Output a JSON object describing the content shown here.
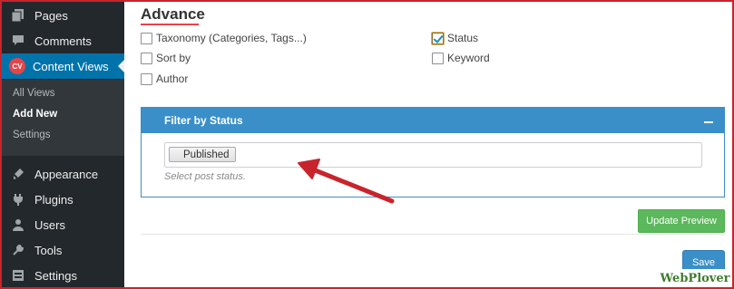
{
  "sidebar": {
    "items": [
      {
        "label": "Pages",
        "icon": "pages-icon"
      },
      {
        "label": "Comments",
        "icon": "comments-icon"
      },
      {
        "label": "Content Views",
        "icon": "content-views-icon",
        "badge": "CV"
      },
      {
        "label": "Appearance",
        "icon": "appearance-icon"
      },
      {
        "label": "Plugins",
        "icon": "plugins-icon"
      },
      {
        "label": "Users",
        "icon": "users-icon"
      },
      {
        "label": "Tools",
        "icon": "tools-icon"
      },
      {
        "label": "Settings",
        "icon": "settings-icon"
      }
    ],
    "submenu": [
      {
        "label": "All Views"
      },
      {
        "label": "Add New"
      },
      {
        "label": "Settings"
      }
    ]
  },
  "main": {
    "section_title": "Advance",
    "options": [
      {
        "label": "Taxonomy (Categories, Tags...)",
        "checked": false
      },
      {
        "label": "Sort by",
        "checked": false
      },
      {
        "label": "Author",
        "checked": false
      },
      {
        "label": "Status",
        "checked": true
      },
      {
        "label": "Keyword",
        "checked": false
      }
    ],
    "panel": {
      "title": "Filter by Status",
      "selected_tag": "Published",
      "help": "Select post status."
    },
    "update_button": "Update Preview",
    "save_button": "Save"
  },
  "watermark": "WebPlover",
  "colors": {
    "accent_blue": "#3a8fc9",
    "sidebar_bg": "#23282d",
    "active_menu": "#0073aa",
    "green_button": "#5cb85c",
    "arrow": "#c8242c"
  }
}
